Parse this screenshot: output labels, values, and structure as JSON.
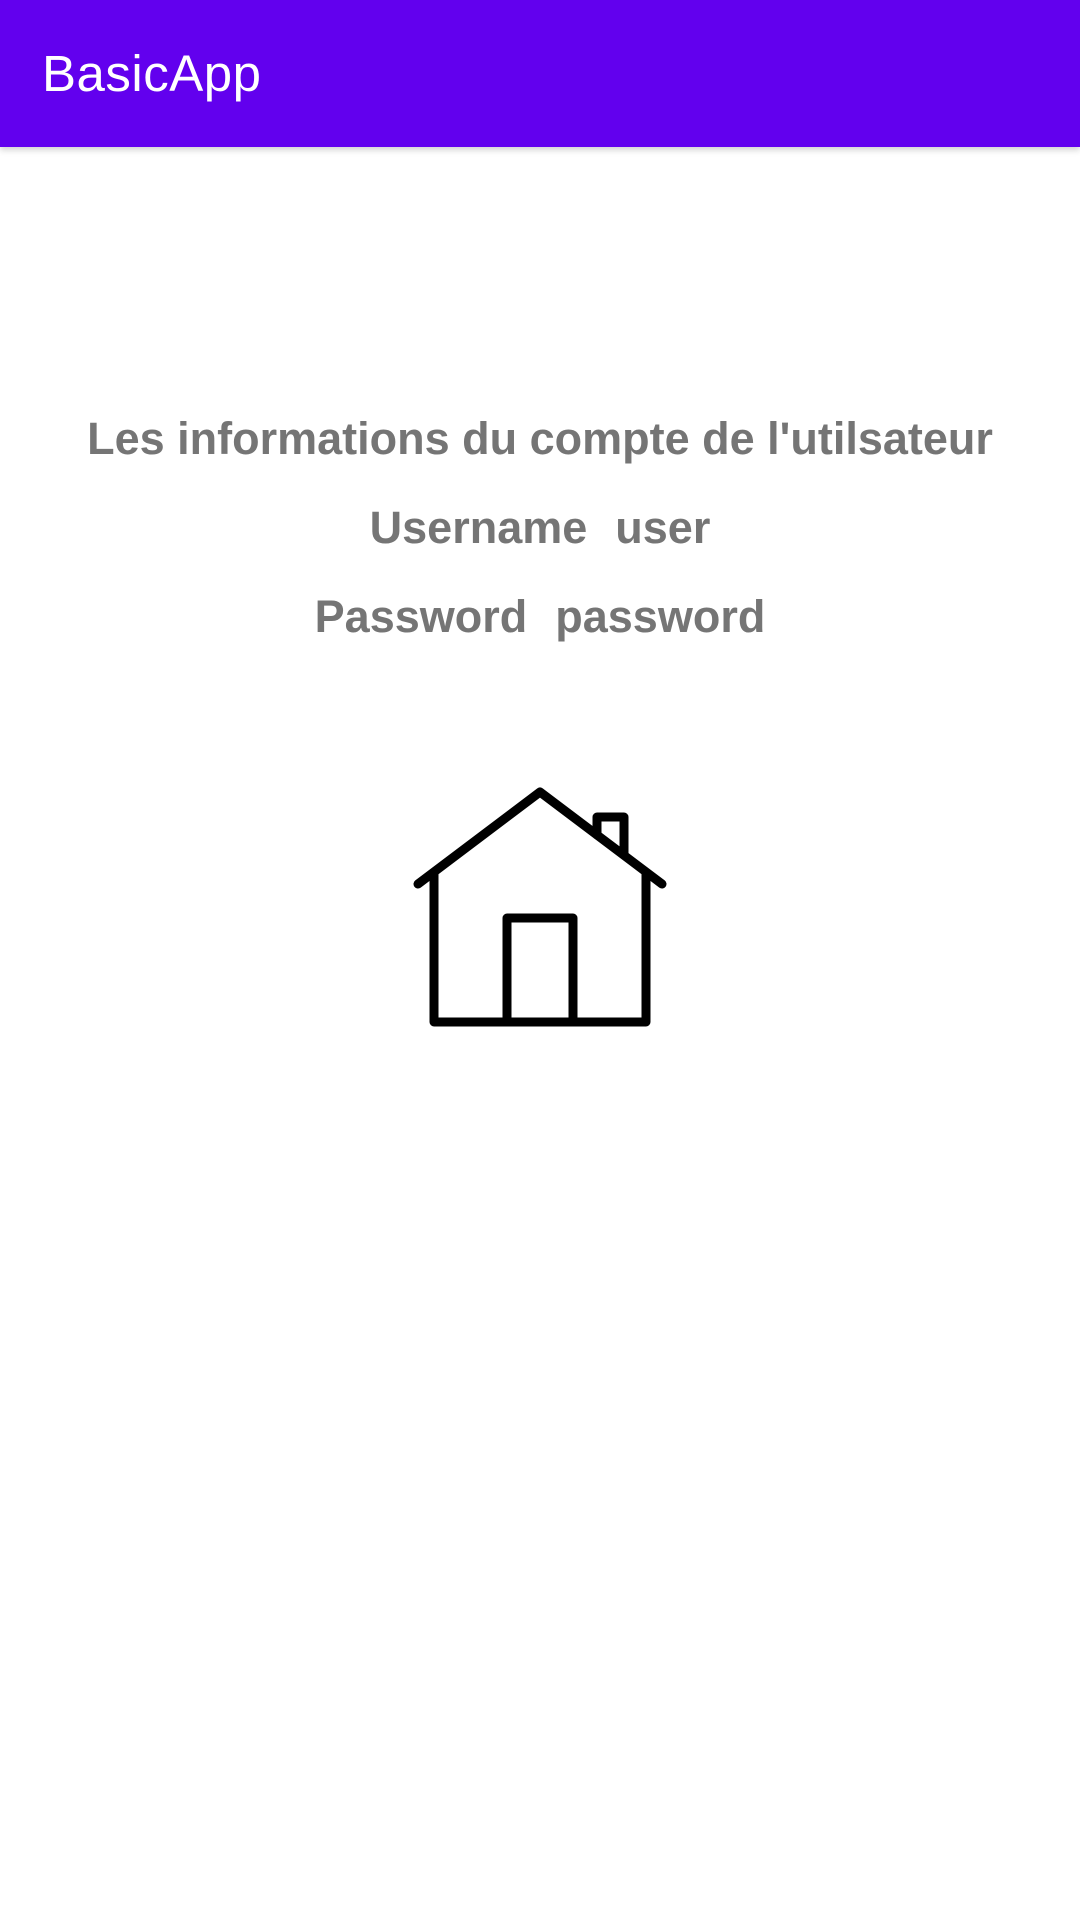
{
  "app_bar": {
    "title": "BasicApp",
    "background": "#6200ee"
  },
  "account": {
    "heading": "Les informations du compte de l'utilsateur",
    "username_label": "Username",
    "username_value": "user",
    "password_label": "Password",
    "password_value": "password",
    "text_color": "#757575"
  },
  "icon": {
    "name": "home-icon"
  }
}
